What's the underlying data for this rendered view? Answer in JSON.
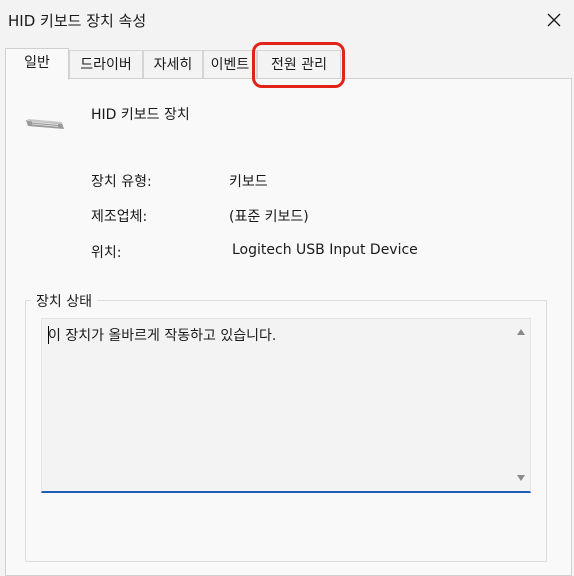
{
  "window": {
    "title": "HID 키보드 장치 속성"
  },
  "tabs": [
    {
      "label": "일반"
    },
    {
      "label": "드라이버"
    },
    {
      "label": "자세히"
    },
    {
      "label": "이벤트"
    },
    {
      "label": "전원 관리"
    }
  ],
  "active_tab": "일반",
  "highlight_color": "#e2231a",
  "device": {
    "icon": "keyboard-icon",
    "name": "HID 키보드 장치",
    "type_label": "장치 유형:",
    "type_value": "키보드",
    "manufacturer_label": "제조업체:",
    "manufacturer_value": "(표준 키보드)",
    "location_label": "위치:",
    "location_value": "Logitech USB Input Device"
  },
  "status": {
    "group_title": "장치 상태",
    "text": "이 장치가 올바르게 작동하고 있습니다."
  }
}
